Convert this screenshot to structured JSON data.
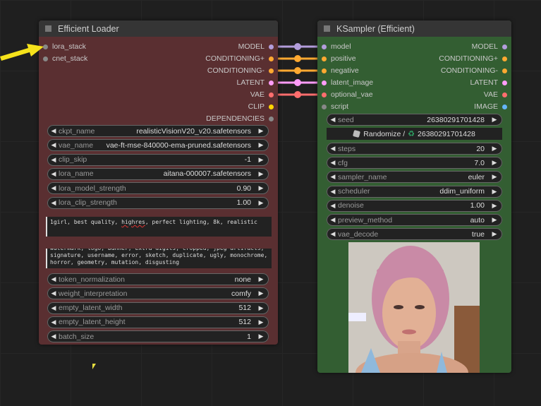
{
  "loader": {
    "title": "Efficient Loader",
    "inputs": [
      {
        "name": "lora_stack",
        "color": "#888888"
      },
      {
        "name": "cnet_stack",
        "color": "#888888"
      }
    ],
    "outputs": [
      {
        "name": "MODEL",
        "color": "#b39ddb"
      },
      {
        "name": "CONDITIONING+",
        "color": "#ffa931"
      },
      {
        "name": "CONDITIONING-",
        "color": "#ffa931"
      },
      {
        "name": "LATENT",
        "color": "#ff9cf9"
      },
      {
        "name": "VAE",
        "color": "#ff6e6e"
      },
      {
        "name": "CLIP",
        "color": "#ffd500"
      },
      {
        "name": "DEPENDENCIES",
        "color": "#888888"
      }
    ],
    "widgets_top": [
      {
        "label": "ckpt_name",
        "value": "realisticVisionV20_v20.safetensors"
      },
      {
        "label": "vae_name",
        "value": "vae-ft-mse-840000-ema-pruned.safetensors"
      },
      {
        "label": "clip_skip",
        "value": "-1"
      },
      {
        "label": "lora_name",
        "value": "aitana-000007.safetensors"
      },
      {
        "label": "lora_model_strength",
        "value": "0.90"
      },
      {
        "label": "lora_clip_strength",
        "value": "1.00"
      }
    ],
    "positive_prompt": {
      "before": "1girl, best quality, ",
      "misspelled": "highres",
      "after": ", perfect lighting, 8k, realistic"
    },
    "negative_prompt": "watermark, logo, banner, extra digits, cropped, jpeg artifacts,\nsignature, username, error, sketch, duplicate, ugly, monochrome,\nhorror, geometry, mutation, disgusting",
    "widgets_bottom": [
      {
        "label": "token_normalization",
        "value": "none"
      },
      {
        "label": "weight_interpretation",
        "value": "comfy"
      },
      {
        "label": "empty_latent_width",
        "value": "512"
      },
      {
        "label": "empty_latent_height",
        "value": "512"
      },
      {
        "label": "batch_size",
        "value": "1"
      }
    ]
  },
  "sampler": {
    "title": "KSampler (Efficient)",
    "inputs": [
      {
        "name": "model",
        "color": "#b39ddb"
      },
      {
        "name": "positive",
        "color": "#ffa931"
      },
      {
        "name": "negative",
        "color": "#ffa931"
      },
      {
        "name": "latent_image",
        "color": "#ff9cf9"
      },
      {
        "name": "optional_vae",
        "color": "#ff6e6e"
      },
      {
        "name": "script",
        "color": "#888888"
      }
    ],
    "outputs": [
      {
        "name": "MODEL",
        "color": "#b39ddb"
      },
      {
        "name": "CONDITIONING+",
        "color": "#ffa931"
      },
      {
        "name": "CONDITIONING-",
        "color": "#ffa931"
      },
      {
        "name": "LATENT",
        "color": "#ff9cf9"
      },
      {
        "name": "VAE",
        "color": "#ff6e6e"
      },
      {
        "name": "IMAGE",
        "color": "#64b5f6"
      }
    ],
    "seed": {
      "label": "seed",
      "value": "26380291701428"
    },
    "randomize": {
      "label": "Randomize /",
      "value": "26380291701428"
    },
    "widgets": [
      {
        "label": "steps",
        "value": "20"
      },
      {
        "label": "cfg",
        "value": "7.0"
      },
      {
        "label": "sampler_name",
        "value": "euler"
      },
      {
        "label": "scheduler",
        "value": "ddim_uniform"
      },
      {
        "label": "denoise",
        "value": "1.00"
      },
      {
        "label": "preview_method",
        "value": "auto"
      },
      {
        "label": "vae_decode",
        "value": "true"
      }
    ],
    "preview_alt": "generated portrait of woman with pink hair"
  },
  "links": [
    {
      "from": "MODEL",
      "to": "model",
      "color": "#b39ddb"
    },
    {
      "from": "CONDITIONING+",
      "to": "positive",
      "color": "#ffa931"
    },
    {
      "from": "CONDITIONING-",
      "to": "negative",
      "color": "#ffa931"
    },
    {
      "from": "LATENT",
      "to": "latent_image",
      "color": "#ff9cf9"
    },
    {
      "from": "VAE",
      "to": "optional_vae",
      "color": "#ff6e6e"
    }
  ],
  "annotation": {
    "arrow_color": "#f5e21b",
    "points_to": "lora_stack"
  }
}
